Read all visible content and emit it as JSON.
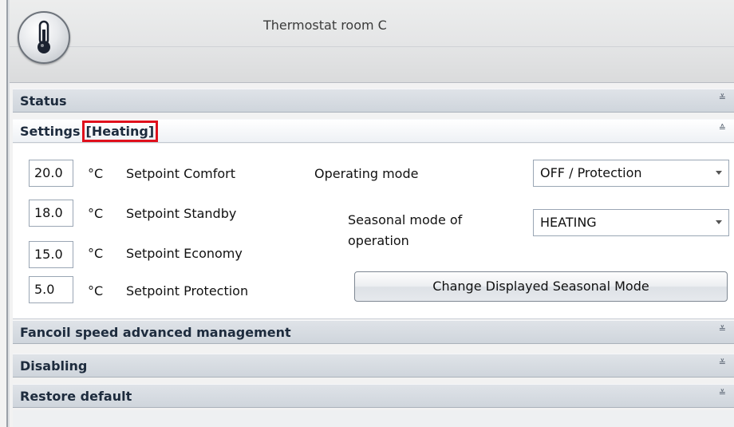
{
  "window": {
    "title": "Thermostat room C",
    "icon": "thermometer-icon"
  },
  "sections": {
    "status": {
      "label": "Status",
      "state": "collapsed"
    },
    "settings": {
      "label": "Settings",
      "mode_tag": "[Heating]",
      "state": "expanded"
    },
    "fancoil": {
      "label": "Fancoil speed advanced management",
      "state": "collapsed"
    },
    "disabling": {
      "label": "Disabling",
      "state": "collapsed"
    },
    "restore": {
      "label": "Restore default",
      "state": "collapsed"
    }
  },
  "chevrons": {
    "expand": "≚",
    "collapse": "≙"
  },
  "setpoints": [
    {
      "value": "20.0",
      "unit": "°C",
      "label": "Setpoint Comfort"
    },
    {
      "value": "18.0",
      "unit": "°C",
      "label": "Setpoint Standby"
    },
    {
      "value": "15.0",
      "unit": "°C",
      "label": "Setpoint Economy"
    },
    {
      "value": "5.0",
      "unit": "°C",
      "label": "Setpoint Protection"
    }
  ],
  "operating_mode": {
    "label": "Operating mode",
    "selected": "OFF / Protection"
  },
  "seasonal_mode": {
    "label_line1": "Seasonal mode of",
    "label_line2": "operation",
    "selected": "HEATING"
  },
  "buttons": {
    "change_seasonal": "Change Displayed Seasonal Mode"
  },
  "colors": {
    "highlight_border": "#e0101c",
    "header_text": "#1d2b3d"
  }
}
